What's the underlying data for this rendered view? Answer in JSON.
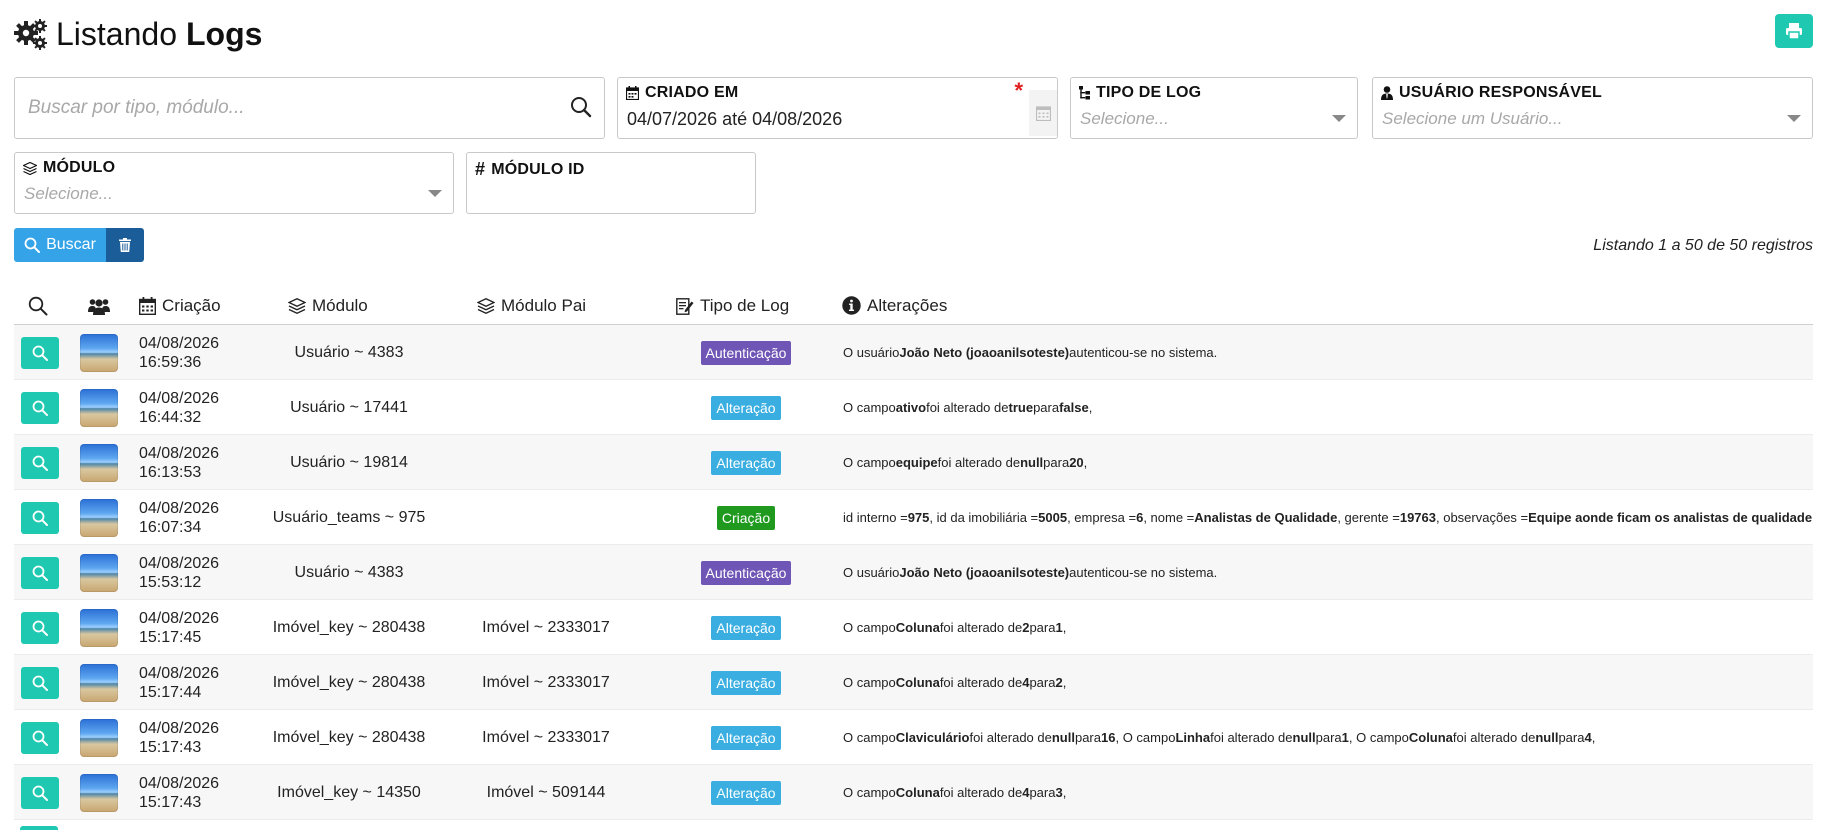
{
  "header": {
    "title_light": "Listando",
    "title_bold": "Logs",
    "gear_icon": "gears-icon",
    "print_icon": "print-icon"
  },
  "filters": {
    "search": {
      "placeholder": "Buscar por tipo, módulo..."
    },
    "criado_em": {
      "label": "CRIADO EM",
      "value": "04/07/2026 até 04/08/2026",
      "required_mark": "*"
    },
    "tipo_de_log": {
      "label": "TIPO DE LOG",
      "placeholder": "Selecione..."
    },
    "usuario_responsavel": {
      "label": "USUÁRIO RESPONSÁVEL",
      "placeholder": "Selecione um Usuário..."
    },
    "modulo": {
      "label": "MÓDULO",
      "placeholder": "Selecione..."
    },
    "modulo_id": {
      "label": "MÓDULO ID",
      "value": ""
    }
  },
  "actions": {
    "buscar_label": "Buscar"
  },
  "listing_info": "Listando 1 a 50 de 50 registros",
  "columns": {
    "criacao": "Criação",
    "modulo": "Módulo",
    "modulo_pai": "Módulo Pai",
    "tipo_de_log": "Tipo de Log",
    "alteracoes": "Alterações"
  },
  "badge_colors": {
    "Autenticação": "#6f55b5",
    "Alteração": "#3aaee0",
    "Criação": "#1f9a1f"
  },
  "rows": [
    {
      "date": "04/08/2026",
      "time": "16:59:36",
      "modulo": "Usuário ~ 4383",
      "modulo_pai": "",
      "tipo": "Autenticação",
      "changes": [
        {
          "t": "O usuário ",
          "b": false
        },
        {
          "t": "João Neto (joaoanilsoteste)",
          "b": true
        },
        {
          "t": " autenticou-se no sistema.",
          "b": false
        }
      ]
    },
    {
      "date": "04/08/2026",
      "time": "16:44:32",
      "modulo": "Usuário ~ 17441",
      "modulo_pai": "",
      "tipo": "Alteração",
      "changes": [
        {
          "t": "O campo ",
          "b": false
        },
        {
          "t": "ativo",
          "b": true
        },
        {
          "t": " foi alterado de ",
          "b": false
        },
        {
          "t": "true",
          "b": true
        },
        {
          "t": " para ",
          "b": false
        },
        {
          "t": "false",
          "b": true
        },
        {
          "t": ",",
          "b": false
        }
      ]
    },
    {
      "date": "04/08/2026",
      "time": "16:13:53",
      "modulo": "Usuário ~ 19814",
      "modulo_pai": "",
      "tipo": "Alteração",
      "changes": [
        {
          "t": "O campo ",
          "b": false
        },
        {
          "t": "equipe",
          "b": true
        },
        {
          "t": " foi alterado de ",
          "b": false
        },
        {
          "t": "null",
          "b": true
        },
        {
          "t": " para ",
          "b": false
        },
        {
          "t": "20",
          "b": true
        },
        {
          "t": ",",
          "b": false
        }
      ]
    },
    {
      "date": "04/08/2026",
      "time": "16:07:34",
      "modulo": "Usuário_teams ~ 975",
      "modulo_pai": "",
      "tipo": "Criação",
      "changes": [
        {
          "t": "id interno = ",
          "b": false
        },
        {
          "t": "975",
          "b": true
        },
        {
          "t": ", id da imobiliária = ",
          "b": false
        },
        {
          "t": "5005",
          "b": true
        },
        {
          "t": ", empresa = ",
          "b": false
        },
        {
          "t": "6",
          "b": true
        },
        {
          "t": ", nome = ",
          "b": false
        },
        {
          "t": "Analistas de Qualidade",
          "b": true
        },
        {
          "t": ", gerente = ",
          "b": false
        },
        {
          "t": "19763",
          "b": true
        },
        {
          "t": ", observações = ",
          "b": false
        },
        {
          "t": "Equipe aonde ficam os analistas de qualidade",
          "b": true
        }
      ]
    },
    {
      "date": "04/08/2026",
      "time": "15:53:12",
      "modulo": "Usuário ~ 4383",
      "modulo_pai": "",
      "tipo": "Autenticação",
      "changes": [
        {
          "t": "O usuário ",
          "b": false
        },
        {
          "t": "João Neto (joaoanilsoteste)",
          "b": true
        },
        {
          "t": " autenticou-se no sistema.",
          "b": false
        }
      ]
    },
    {
      "date": "04/08/2026",
      "time": "15:17:45",
      "modulo": "Imóvel_key ~ 280438",
      "modulo_pai": "Imóvel ~ 2333017",
      "tipo": "Alteração",
      "changes": [
        {
          "t": "O campo ",
          "b": false
        },
        {
          "t": "Coluna",
          "b": true
        },
        {
          "t": " foi alterado de ",
          "b": false
        },
        {
          "t": "2",
          "b": true
        },
        {
          "t": " para ",
          "b": false
        },
        {
          "t": "1",
          "b": true
        },
        {
          "t": ",",
          "b": false
        }
      ]
    },
    {
      "date": "04/08/2026",
      "time": "15:17:44",
      "modulo": "Imóvel_key ~ 280438",
      "modulo_pai": "Imóvel ~ 2333017",
      "tipo": "Alteração",
      "changes": [
        {
          "t": "O campo ",
          "b": false
        },
        {
          "t": "Coluna",
          "b": true
        },
        {
          "t": " foi alterado de ",
          "b": false
        },
        {
          "t": "4",
          "b": true
        },
        {
          "t": " para ",
          "b": false
        },
        {
          "t": "2",
          "b": true
        },
        {
          "t": ",",
          "b": false
        }
      ]
    },
    {
      "date": "04/08/2026",
      "time": "15:17:43",
      "modulo": "Imóvel_key ~ 280438",
      "modulo_pai": "Imóvel ~ 2333017",
      "tipo": "Alteração",
      "changes": [
        {
          "t": "O campo ",
          "b": false
        },
        {
          "t": "Claviculário",
          "b": true
        },
        {
          "t": " foi alterado de ",
          "b": false
        },
        {
          "t": "null",
          "b": true
        },
        {
          "t": " para ",
          "b": false
        },
        {
          "t": "16",
          "b": true
        },
        {
          "t": ", O campo ",
          "b": false
        },
        {
          "t": "Linha",
          "b": true
        },
        {
          "t": " foi alterado de ",
          "b": false
        },
        {
          "t": "null",
          "b": true
        },
        {
          "t": " para ",
          "b": false
        },
        {
          "t": "1",
          "b": true
        },
        {
          "t": ", O campo ",
          "b": false
        },
        {
          "t": "Coluna",
          "b": true
        },
        {
          "t": " foi alterado de ",
          "b": false
        },
        {
          "t": "null",
          "b": true
        },
        {
          "t": " para ",
          "b": false
        },
        {
          "t": "4",
          "b": true
        },
        {
          "t": ",",
          "b": false
        }
      ]
    },
    {
      "date": "04/08/2026",
      "time": "15:17:43",
      "modulo": "Imóvel_key ~ 14350",
      "modulo_pai": "Imóvel ~ 509144",
      "tipo": "Alteração",
      "changes": [
        {
          "t": "O campo ",
          "b": false
        },
        {
          "t": "Coluna",
          "b": true
        },
        {
          "t": " foi alterado de ",
          "b": false
        },
        {
          "t": "4",
          "b": true
        },
        {
          "t": " para ",
          "b": false
        },
        {
          "t": "3",
          "b": true
        },
        {
          "t": ",",
          "b": false
        }
      ]
    }
  ]
}
